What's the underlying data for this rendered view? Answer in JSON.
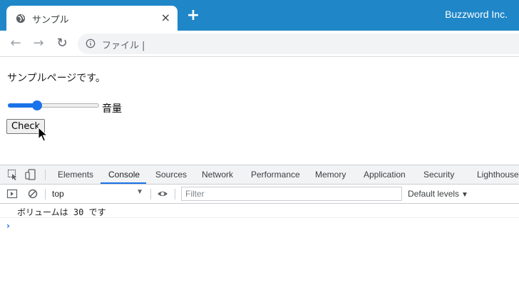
{
  "browser": {
    "tab_title": "サンプル",
    "tab_close": "×",
    "new_tab": "+",
    "brand": "Buzzword Inc.",
    "address_label": "ファイル",
    "address_caret": "|",
    "nav": {
      "back": "←",
      "forward": "→",
      "reload": "↻"
    },
    "colors": {
      "title_bar": "#1f86c8",
      "accent": "#1a73e8"
    }
  },
  "page": {
    "intro_text": "サンプルページです。",
    "volume_slider": {
      "value": 30,
      "min": 0,
      "max": 100
    },
    "volume_label": "音量",
    "check_button": "Check"
  },
  "devtools": {
    "tabs": [
      "Elements",
      "Console",
      "Sources",
      "Network",
      "Performance",
      "Memory",
      "Application",
      "Security",
      "Lighthouse"
    ],
    "active_tab": "Console",
    "context": "top",
    "context_arrow": "▼",
    "filter_placeholder": "Filter",
    "levels": "Default levels",
    "levels_arrow": "▼",
    "console_output": "ボリュームは 30 です",
    "prompt": "›",
    "icons": [
      "inspect-element-icon",
      "device-toolbar-icon",
      "sidebar-toggle-icon",
      "clear-console-icon",
      "eye-icon"
    ]
  }
}
